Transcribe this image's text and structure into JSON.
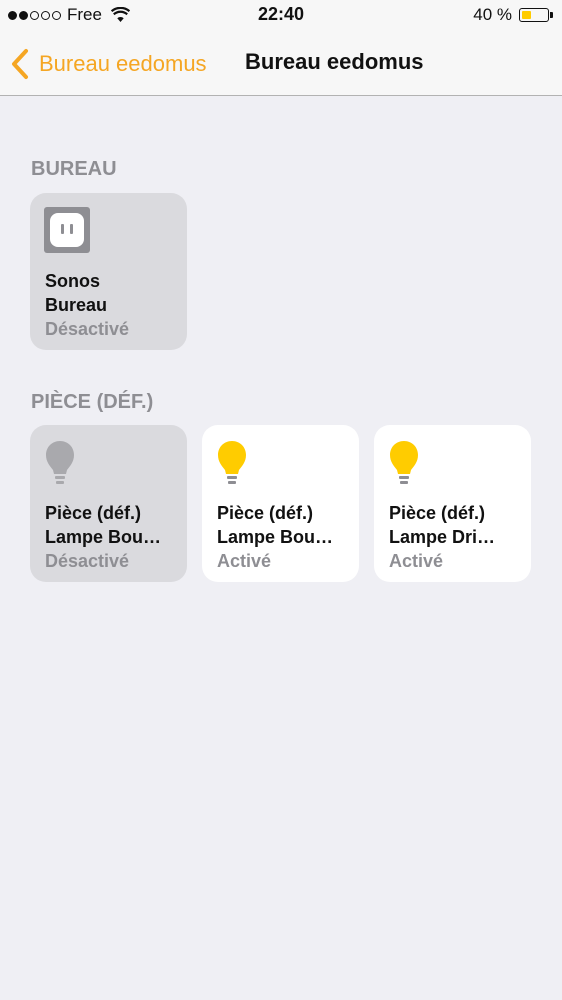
{
  "status_bar": {
    "signal_dots": [
      true,
      true,
      false,
      false,
      false
    ],
    "carrier": "Free",
    "wifi_icon": "wifi-icon",
    "time": "22:40",
    "battery_percent_label": "40 %",
    "battery_level": 0.4,
    "battery_color": "#ffcc00"
  },
  "nav": {
    "back_label": "Bureau eedomus",
    "title": "Bureau eedomus",
    "accent_color": "#f5a623"
  },
  "sections": [
    {
      "header": "BUREAU",
      "tiles": [
        {
          "icon": "outlet-icon",
          "line1": "Sonos",
          "line2": "Bureau",
          "status": "Désactivé",
          "state": "off"
        }
      ]
    },
    {
      "header": "PIÈCE (DÉF.)",
      "tiles": [
        {
          "icon": "lightbulb-icon",
          "line1": "Pièce (déf.)",
          "line2": "Lampe Bou…",
          "status": "Désactivé",
          "state": "off"
        },
        {
          "icon": "lightbulb-icon",
          "line1": "Pièce (déf.)",
          "line2": "Lampe Bou…",
          "status": "Activé",
          "state": "on"
        },
        {
          "icon": "lightbulb-icon",
          "line1": "Pièce (déf.)",
          "line2": "Lampe Dri…",
          "status": "Activé",
          "state": "on"
        }
      ]
    }
  ]
}
